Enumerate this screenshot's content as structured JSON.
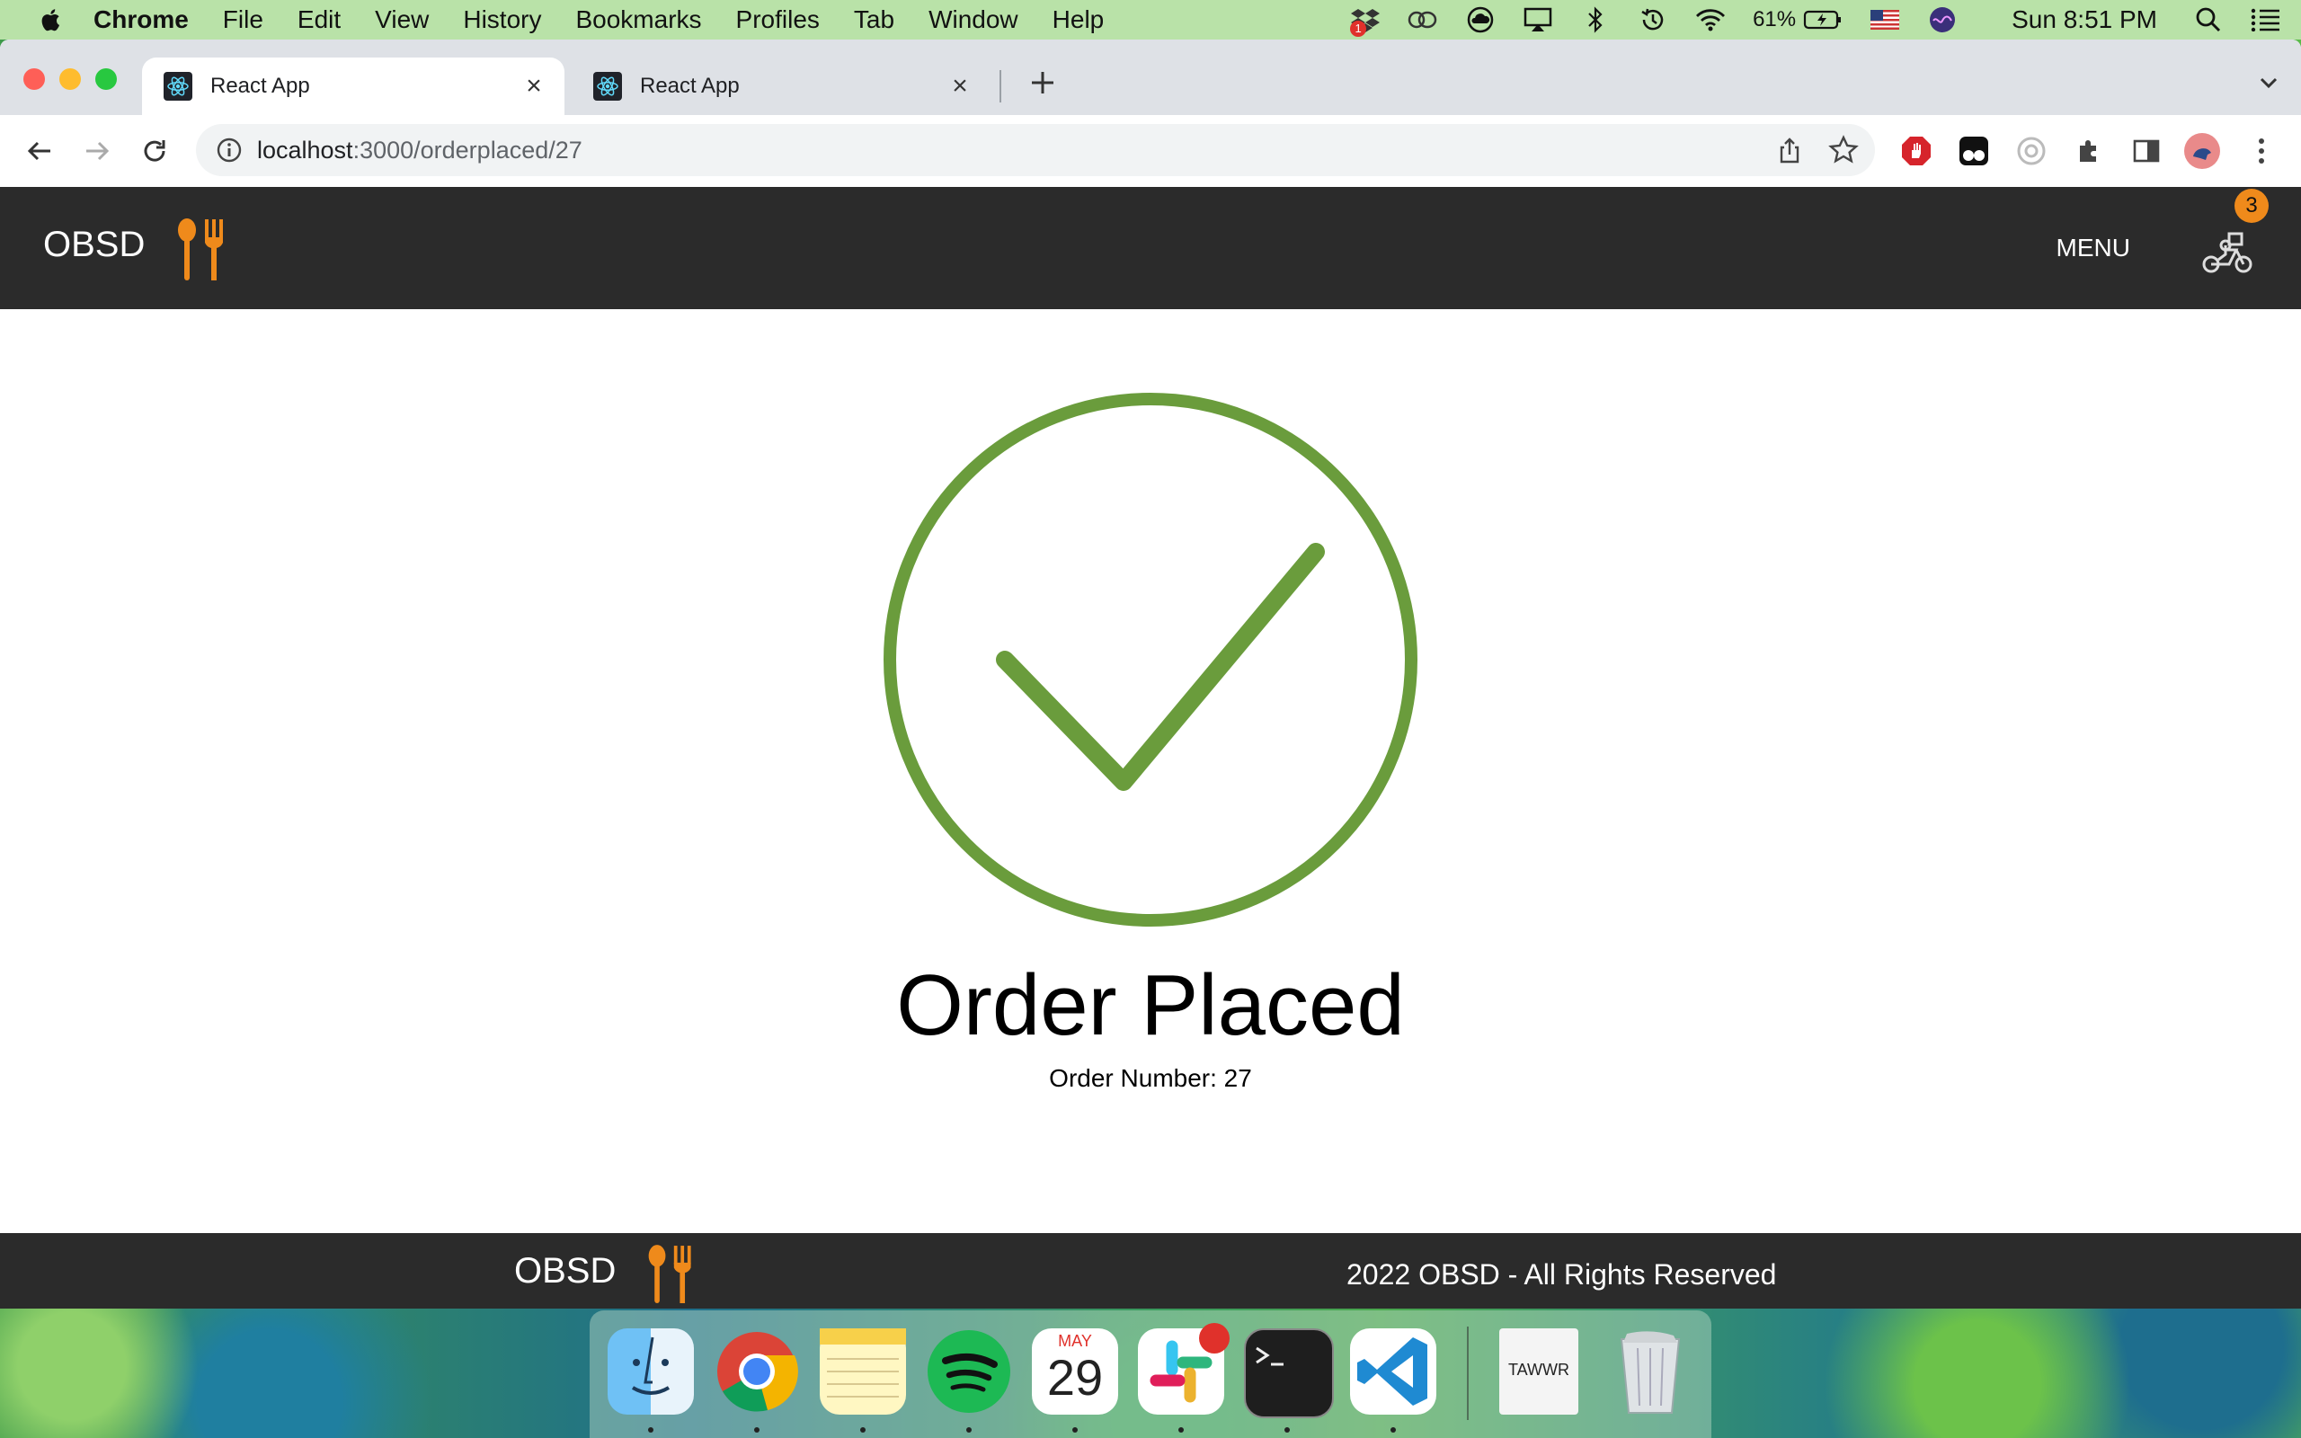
{
  "menubar": {
    "items": [
      "Chrome",
      "File",
      "Edit",
      "View",
      "History",
      "Bookmarks",
      "Profiles",
      "Tab",
      "Window",
      "Help"
    ],
    "battery": "61%",
    "clock": "Sun 8:51 PM",
    "dropbox_badge": "1"
  },
  "browser": {
    "tabs": [
      {
        "label": "React App",
        "active": true
      },
      {
        "label": "React App",
        "active": false
      }
    ],
    "url_host": "localhost",
    "url_path": ":3000/orderplaced/27"
  },
  "app": {
    "brand": "OBSD",
    "menu_label": "MENU",
    "cart_count": "3",
    "order_title": "Order Placed",
    "order_number_label": "Order Number:",
    "order_number": "27",
    "footer_brand": "OBSD",
    "footer_copyright": "2022 OBSD - All Rights Reserved"
  },
  "dock": {
    "apps": [
      "finder-icon",
      "chrome-icon",
      "notes-icon",
      "spotify-icon",
      "calendar-icon",
      "slack-icon",
      "terminal-icon",
      "vscode-icon",
      "document-icon",
      "trash-icon"
    ],
    "calendar_month": "MAY",
    "calendar_day": "29",
    "document_label": "TAWWR"
  },
  "colors": {
    "accent_orange": "#ef8a1b",
    "check_green": "#6a9c3c",
    "nav_dark": "#2b2b2b"
  }
}
